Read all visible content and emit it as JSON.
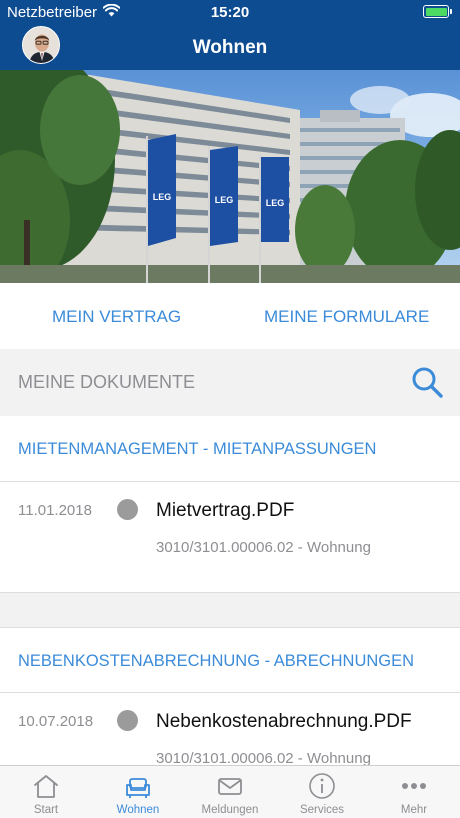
{
  "status_bar": {
    "carrier": "Netzbetreiber",
    "time": "15:20",
    "battery_level": 1.0
  },
  "header": {
    "title": "Wohnen"
  },
  "hero": {
    "flag_text": "LEG"
  },
  "links": {
    "contract": "MEIN VERTRAG",
    "forms": "MEINE FORMULARE"
  },
  "documents": {
    "title": "MEINE DOKUMENTE",
    "categories": [
      {
        "label": "MIETENMANAGEMENT - MIETANPASSUNGEN",
        "items": [
          {
            "date": "11.01.2018",
            "name": "Mietvertrag.PDF",
            "ref": "3010/3101.00006.02 - Wohnung"
          }
        ]
      },
      {
        "label": "NEBENKOSTENABRECHNUNG - ABRECHNUNGEN",
        "items": [
          {
            "date": "10.07.2018",
            "name": "Nebenkostenabrechnung.PDF",
            "ref": "3010/3101.00006.02 - Wohnung"
          }
        ]
      }
    ]
  },
  "tabbar": {
    "active": "Wohnen",
    "tabs": [
      {
        "label": "Start",
        "icon": "home-icon"
      },
      {
        "label": "Wohnen",
        "icon": "sofa-icon"
      },
      {
        "label": "Meldungen",
        "icon": "envelope-icon"
      },
      {
        "label": "Services",
        "icon": "info-icon"
      },
      {
        "label": "Mehr",
        "icon": "more-dots-icon"
      }
    ]
  },
  "colors": {
    "header": "#0e4c92",
    "accent": "#3b8bd9",
    "section_bg": "#f2f2f2",
    "muted_text": "#8e8e93",
    "battery": "#4cd964"
  }
}
